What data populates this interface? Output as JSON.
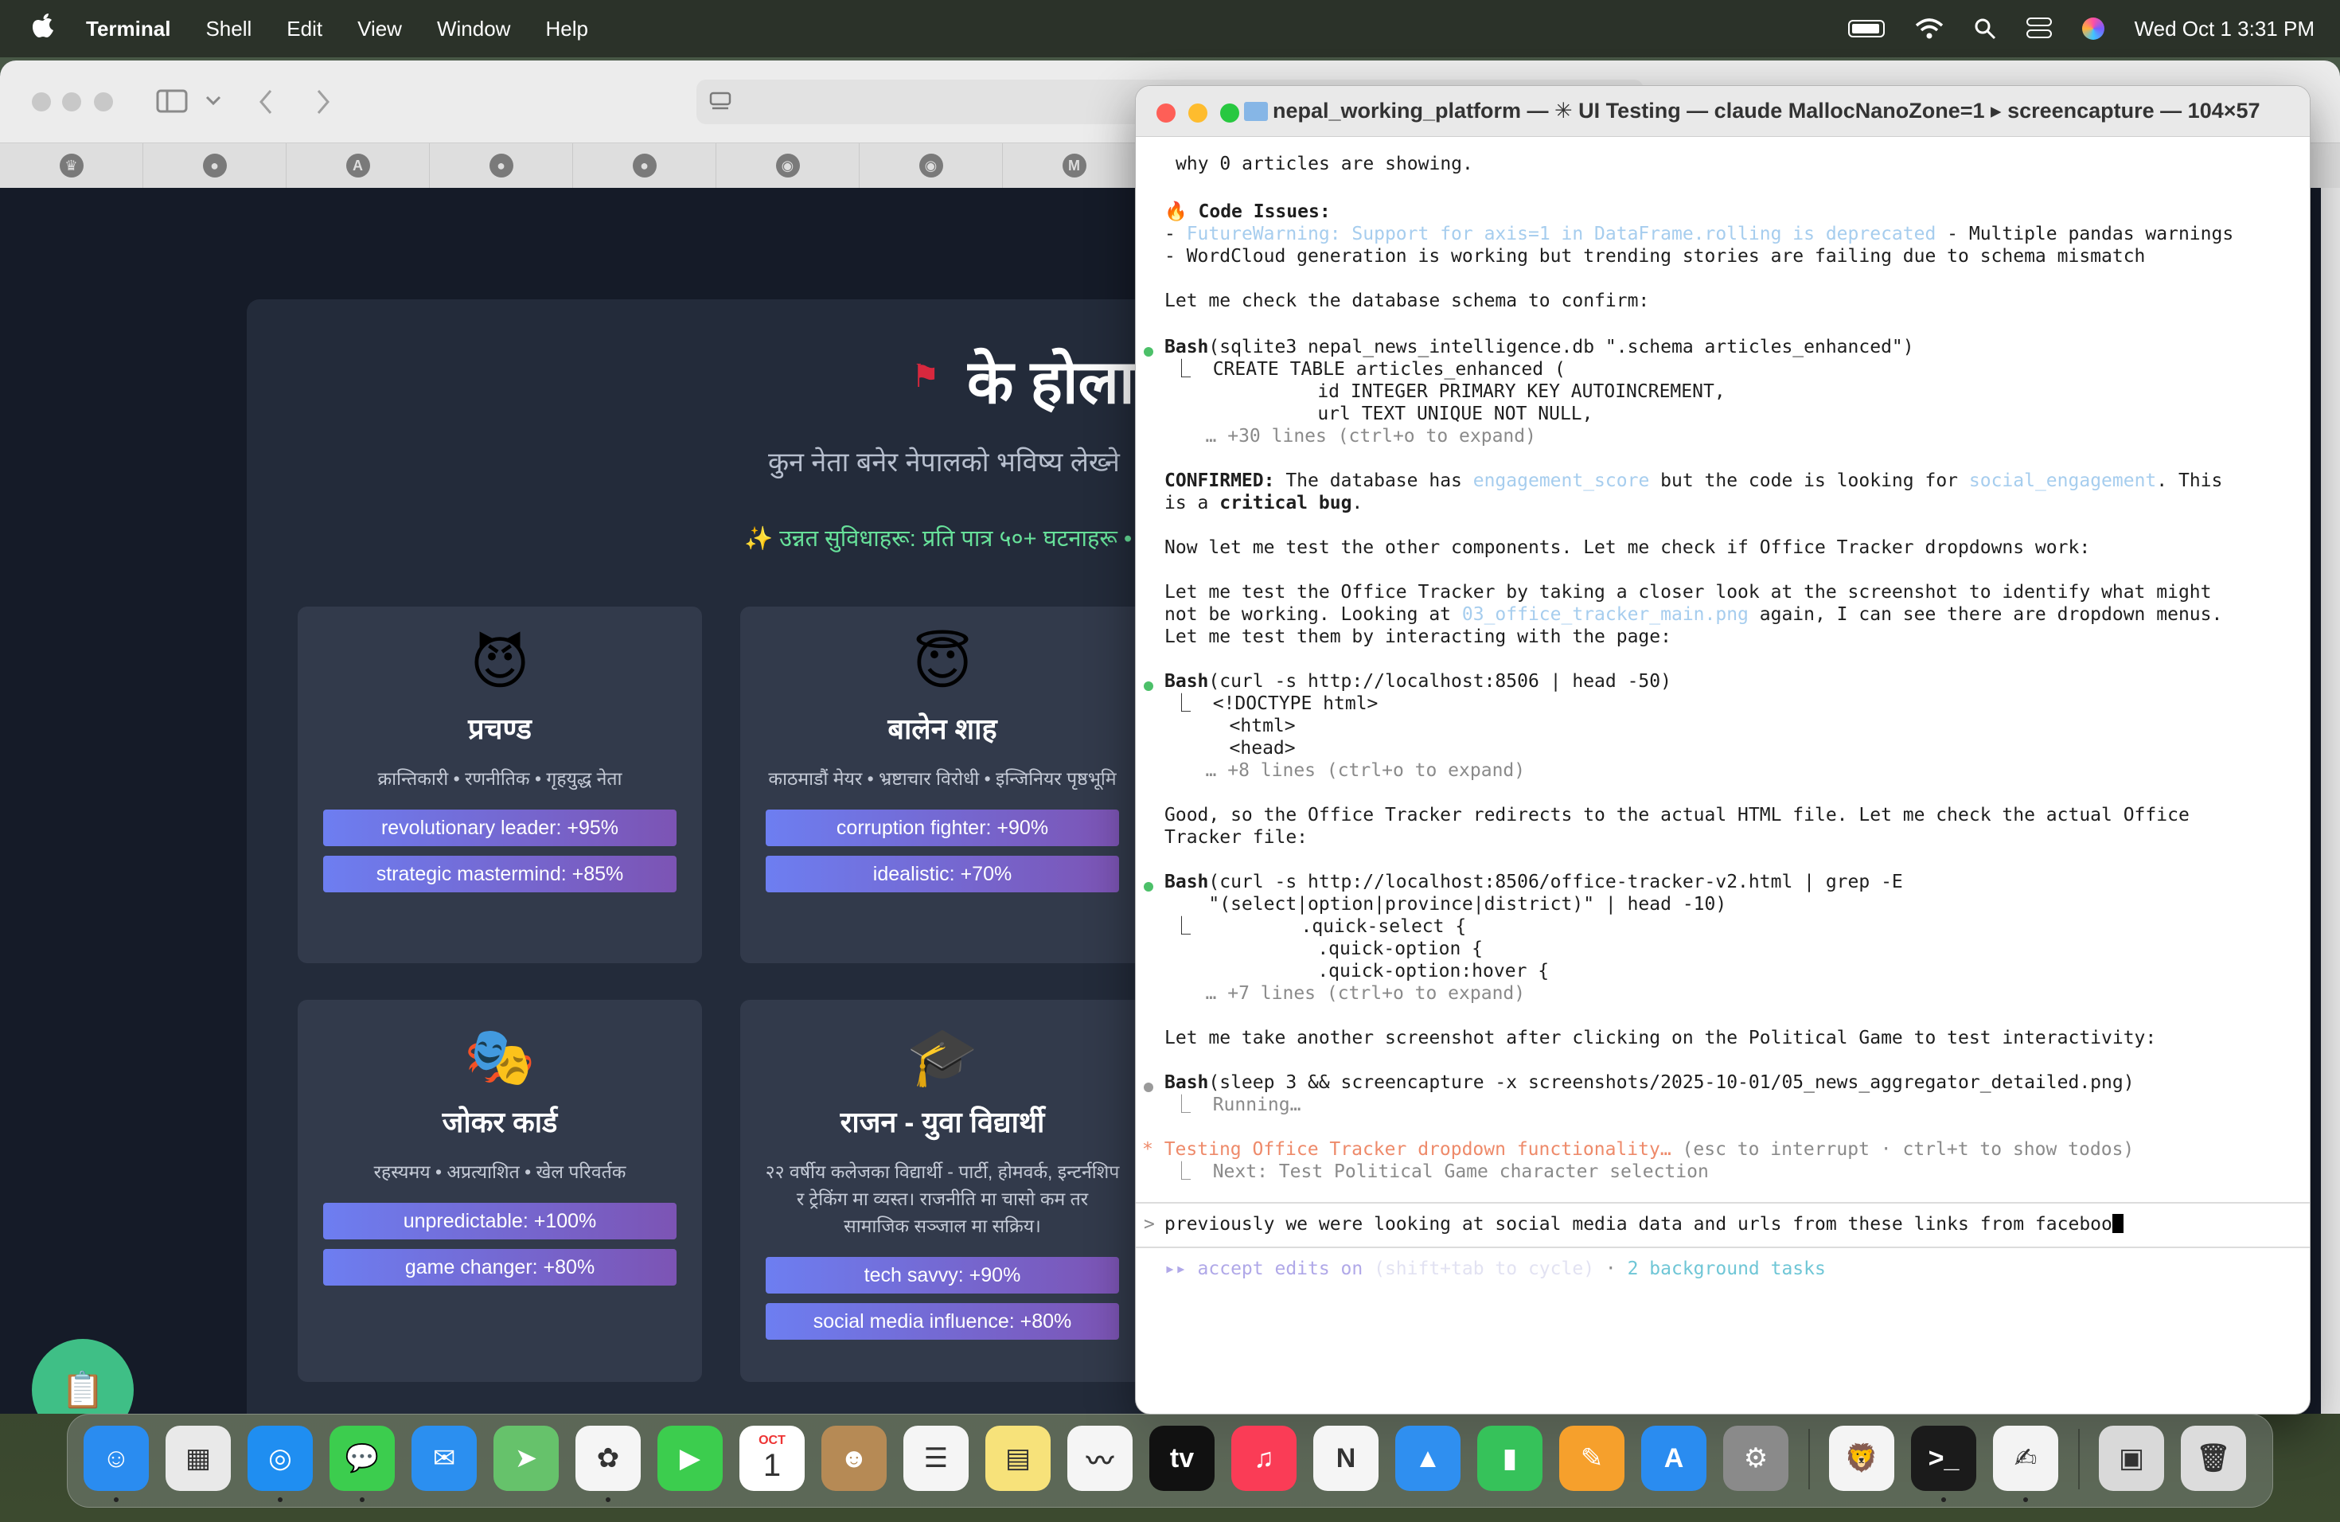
{
  "menubar": {
    "apple_icon": "apple-logo-icon",
    "app_name": "Terminal",
    "items": [
      "Shell",
      "Edit",
      "View",
      "Window",
      "Help"
    ],
    "datetime": "Wed Oct 1  3:31 PM"
  },
  "browser": {
    "page": {
      "flag_glyph": "⚑",
      "hero_title": "के होला",
      "hero_subtitle": "कुन नेता बनेर नेपालको भविष्य लेख्ने",
      "hero_features": "✨ उन्नत सुविधाहरू: प्रति पात्र ५०+ घटनाहरू •",
      "cards": [
        {
          "emoji": "😈",
          "name": "प्रचण्ड",
          "desc": "क्रान्तिकारी • रणनीतिक • गृहयुद्ध नेता",
          "traits": [
            "revolutionary leader: +95%",
            "strategic mastermind: +85%"
          ]
        },
        {
          "emoji": "😇",
          "name": "बालेन शाह",
          "desc": "काठमाडौं मेयर • भ्रष्टाचार विरोधी • इन्जिनियर पृष्ठभूमि",
          "traits": [
            "corruption fighter: +90%",
            "idealistic: +70%"
          ]
        },
        {
          "emoji": "🎭",
          "name": "जोकर कार्ड",
          "desc": "रहस्यमय • अप्रत्याशित • खेल परिवर्तक",
          "traits": [
            "unpredictable: +100%",
            "game changer: +80%"
          ]
        },
        {
          "emoji": "🎓",
          "name": "राजन - युवा विद्यार्थी",
          "desc": "२२ वर्षीय कलेजका विद्यार्थी - पार्टी, होमवर्क, इन्टर्नशिप र ट्रेकिंग मा व्यस्त। राजनीति मा चासो कम तर सामाजिक सञ्जाल मा सक्रिय।",
          "traits": [
            "tech savvy: +90%",
            "social media influence: +80%"
          ]
        }
      ],
      "fab_icon": "📋"
    }
  },
  "terminal": {
    "title": "nepal_working_platform — ✳ UI Testing — claude MallocNanoZone=1 ▸ screencapture — 104×57",
    "lines": {
      "l1": "why 0 articles are showing.",
      "l2_emoji": "🔥",
      "l2": "Code Issues:",
      "l3a": "- ",
      "l3b": "FutureWarning: Support for axis=1 in DataFrame.rolling is deprecated",
      "l3c": " - Multiple pandas warnings",
      "l4": "- WordCloud generation is working but trending stories are failing due to schema mismatch",
      "l5": "Let me check the database schema to confirm:",
      "l6a": "Bash",
      "l6b": "(sqlite3 nepal_news_intelligence.db \".schema articles_enhanced\")",
      "l7": "⎿  CREATE TABLE articles_enhanced (",
      "l8": "           id INTEGER PRIMARY KEY AUTOINCREMENT,",
      "l9": "           url TEXT UNIQUE NOT NULL,",
      "l10": "   … +30 lines (ctrl+o to expand)",
      "l11a": "CONFIRMED:",
      "l11b": " The database has ",
      "l11c": "engagement_score",
      "l11d": " but the code is looking for ",
      "l11e": "social_engagement",
      "l11f": ". This",
      "l12a": "is a ",
      "l12b": "critical bug",
      "l12c": ".",
      "l13": "Now let me test the other components. Let me check if Office Tracker dropdowns work:",
      "l14": "Let me test the Office Tracker by taking a closer look at the screenshot to identify what might",
      "l15a": "not be working. Looking at ",
      "l15b": "03_office_tracker_main.png",
      "l15c": " again, I can see there are dropdown menus.",
      "l16": "Let me test them by interacting with the page:",
      "l17a": "Bash",
      "l17b": "(curl -s http://localhost:8506 | head -50)",
      "l18": "⎿  <!DOCTYPE html>",
      "l19": "   <html>",
      "l20": "   <head>",
      "l21": "   … +8 lines (ctrl+o to expand)",
      "l22": "Good, so the Office Tracker redirects to the actual HTML file. Let me check the actual Office",
      "l23": "Tracker file:",
      "l24a": "Bash",
      "l24b": "(curl -s http://localhost:8506/office-tracker-v2.html | grep -E",
      "l25": "    \"(select|option|province|district)\" | head -10)",
      "l26": "⎿          .quick-select {",
      "l27": "           .quick-option {",
      "l28": "           .quick-option:hover {",
      "l29": "   … +7 lines (ctrl+o to expand)",
      "l30": "Let me take another screenshot after clicking on the Political Game to test interactivity:",
      "l31a": "Bash",
      "l31b": "(sleep 3 && screencapture -x screenshots/2025-10-01/05_news_aggregator_detailed.png)",
      "l32": "⎿  Running…",
      "l33a": "* ",
      "l33b": "Testing Office Tracker dropdown functionality…",
      "l33c": " (esc to interrupt · ctrl+t to show todos)",
      "l34": "⎿  Next: Test Political Game character selection"
    },
    "prompt_char": ">",
    "input_value": "previously we were looking at social media data and urls from these links from faceboo",
    "mode_a": "▸▸ accept edits on",
    "mode_b": " (shift+tab to cycle)",
    "mode_c": " · ",
    "bg_tasks": "2 background tasks"
  },
  "dock": {
    "apps": [
      {
        "name": "Finder",
        "icon": "finder-icon",
        "glyph": "☺",
        "color": "#2a8cf0"
      },
      {
        "name": "Launchpad",
        "icon": "launchpad-icon",
        "glyph": "▦",
        "color": "#e9e9e9"
      },
      {
        "name": "Safari",
        "icon": "safari-icon",
        "glyph": "◎",
        "color": "#1f8ef1"
      },
      {
        "name": "Messages",
        "icon": "messages-icon",
        "glyph": "💬",
        "color": "#3ccd4e"
      },
      {
        "name": "Mail",
        "icon": "mail-icon",
        "glyph": "✉",
        "color": "#2b8ff0"
      },
      {
        "name": "Maps",
        "icon": "maps-icon",
        "glyph": "➤",
        "color": "#66c26b"
      },
      {
        "name": "Photos",
        "icon": "photos-icon",
        "glyph": "✿",
        "color": "#f5f5f5"
      },
      {
        "name": "FaceTime",
        "icon": "facetime-icon",
        "glyph": "▶",
        "color": "#3ccd4e"
      },
      {
        "name": "Calendar",
        "icon": "calendar-icon",
        "glyph": "1",
        "color": "#ffffff"
      },
      {
        "name": "Contacts",
        "icon": "contacts-icon",
        "glyph": "☻",
        "color": "#b68a55"
      },
      {
        "name": "Reminders",
        "icon": "reminders-icon",
        "glyph": "☰",
        "color": "#f5f5f5"
      },
      {
        "name": "Notes",
        "icon": "notes-icon",
        "glyph": "▤",
        "color": "#f7e27a"
      },
      {
        "name": "Freeform",
        "icon": "freeform-icon",
        "glyph": "〰",
        "color": "#f5f5f5"
      },
      {
        "name": "TV",
        "icon": "apple-tv-icon",
        "glyph": "tv",
        "color": "#111111"
      },
      {
        "name": "Music",
        "icon": "music-icon",
        "glyph": "♫",
        "color": "#fa3c56"
      },
      {
        "name": "News",
        "icon": "news-icon",
        "glyph": "N",
        "color": "#f5f5f5"
      },
      {
        "name": "Keynote",
        "icon": "keynote-icon",
        "glyph": "▲",
        "color": "#2f8ff0"
      },
      {
        "name": "Numbers",
        "icon": "numbers-icon",
        "glyph": "▮",
        "color": "#36c25a"
      },
      {
        "name": "Pages",
        "icon": "pages-icon",
        "glyph": "✎",
        "color": "#f6a02c"
      },
      {
        "name": "App Store",
        "icon": "app-store-icon",
        "glyph": "A",
        "color": "#2a8cf0"
      },
      {
        "name": "System Settings",
        "icon": "settings-icon",
        "glyph": "⚙",
        "color": "#8a8a8a"
      },
      {
        "name": "Brave",
        "icon": "brave-icon",
        "glyph": "🦁",
        "color": "#f4f4f4"
      },
      {
        "name": "Terminal",
        "icon": "terminal-icon",
        "glyph": ">_",
        "color": "#1b1b1b"
      },
      {
        "name": "TextEdit",
        "icon": "textedit-icon",
        "glyph": "✍",
        "color": "#f3f3f3"
      },
      {
        "name": "Preview",
        "icon": "preview-icon",
        "glyph": "▣",
        "color": "#d9d9d9"
      },
      {
        "name": "Trash",
        "icon": "trash-icon",
        "glyph": "🗑",
        "color": "#dcdcdc"
      }
    ],
    "calendar_month": "OCT",
    "calendar_day": "1"
  }
}
